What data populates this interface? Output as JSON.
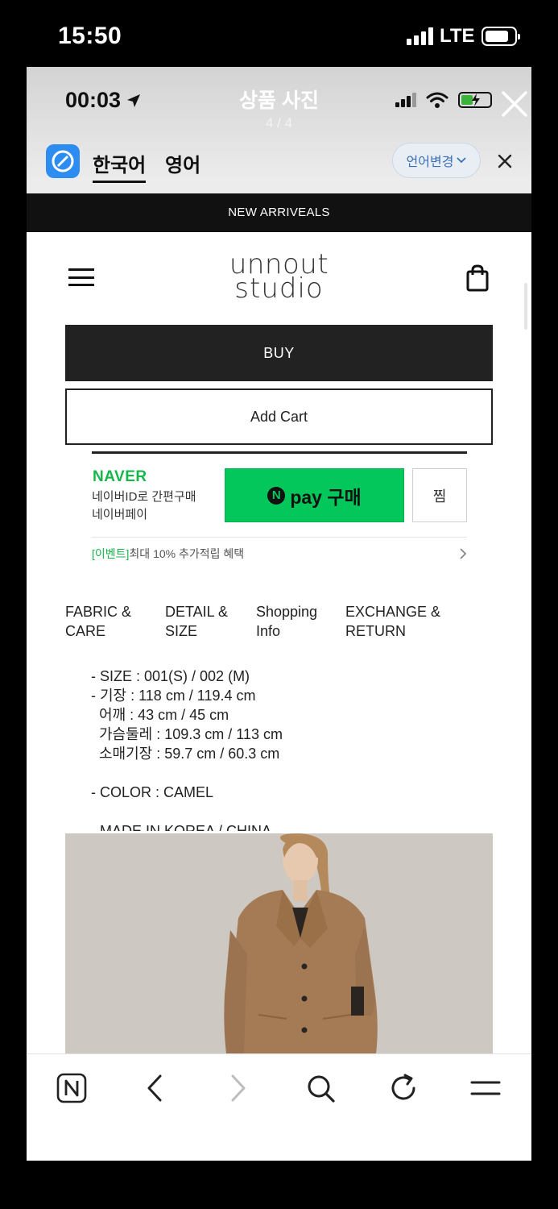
{
  "outer_status": {
    "time": "15:50",
    "network": "LTE"
  },
  "viewer": {
    "title": "상품 사진",
    "counter": "4 / 4"
  },
  "inner_status": {
    "time": "00:03"
  },
  "translate_bar": {
    "tab_korean": "한국어",
    "tab_english": "영어",
    "change_language": "언어변경"
  },
  "promo": {
    "text": "NEW ARRIVEALS"
  },
  "header": {
    "logo_line1": "unnout",
    "logo_line2": "studio"
  },
  "buttons": {
    "buy": "BUY",
    "add_cart": "Add Cart"
  },
  "naver": {
    "brand": "NAVER",
    "desc_line1": "네이버ID로 간편구매",
    "desc_line2": "네이버페이",
    "pay_mark": "N",
    "pay_label": "pay 구매",
    "wish": "찜",
    "event_tag": "[이벤트]",
    "event_text": "최대 10% 추가적립 혜택"
  },
  "info_tabs": [
    {
      "line1": "FABRIC &",
      "line2": "CARE"
    },
    {
      "line1": "DETAIL &",
      "line2": "SIZE"
    },
    {
      "line1": "Shopping",
      "line2": "Info"
    },
    {
      "line1": "EXCHANGE &",
      "line2": "RETURN"
    }
  ],
  "details": {
    "size": "- SIZE : 001(S) / 002 (M)",
    "length": "- 기장 : 118 cm / 119.4 cm",
    "shoulder": "어깨 : 43 cm / 45 cm",
    "chest": "가슴둘레 : 109.3 cm / 113 cm",
    "sleeve": "소매기장 : 59.7 cm / 60.3 cm",
    "color": "- COLOR : CAMEL",
    "made_in": "- MADE IN KOREA / CHINA"
  },
  "colors": {
    "naver_green": "#03c75a",
    "coat": "#a57b55",
    "wall": "#c9c4bd"
  }
}
